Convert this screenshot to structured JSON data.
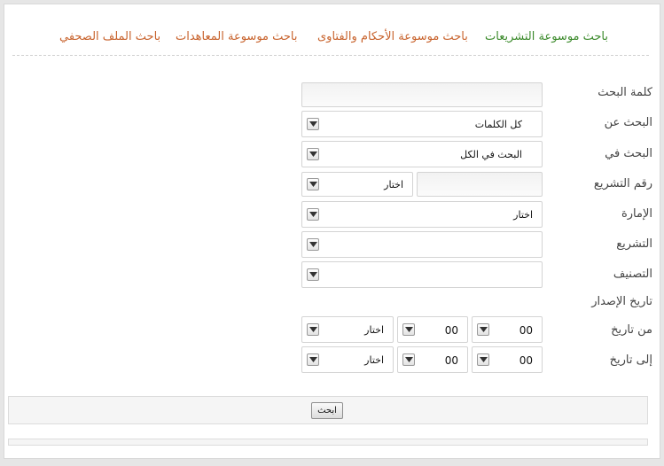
{
  "tabs": [
    {
      "label": "باحث موسوعة التشريعات",
      "active": true
    },
    {
      "label": "باحث موسوعة الأحكام والفتاوى",
      "active": false
    },
    {
      "label": "باحث موسوعة المعاهدات",
      "active": false
    },
    {
      "label": "باحث الملف الصحفي",
      "active": false
    }
  ],
  "colors": {
    "tab_active": "#3b8a2b",
    "tab_inactive": "#c8632d"
  },
  "form": {
    "keyword_label": "كلمة البحث",
    "keyword_value": "",
    "search_for_label": "البحث عن",
    "search_for_value": "كل الكلمات",
    "search_in_label": "البحث في",
    "search_in_value": "البحث في الكل",
    "law_number_label": "رقم التشريع",
    "law_number_value": "",
    "law_number_select": "اختار",
    "emirate_label": "الإمارة",
    "emirate_value": "اختار",
    "legislation_label": "التشريع",
    "legislation_value": "",
    "classification_label": "التصنيف",
    "classification_value": "",
    "issue_date_label": "تاريخ الإصدار",
    "from_date_label": "من تاريخ",
    "from_day": "00",
    "from_month": "00",
    "from_year": "اختار",
    "to_date_label": "إلى تاريخ",
    "to_day": "00",
    "to_month": "00",
    "to_year": "اختار"
  },
  "search_button": "ابحث"
}
